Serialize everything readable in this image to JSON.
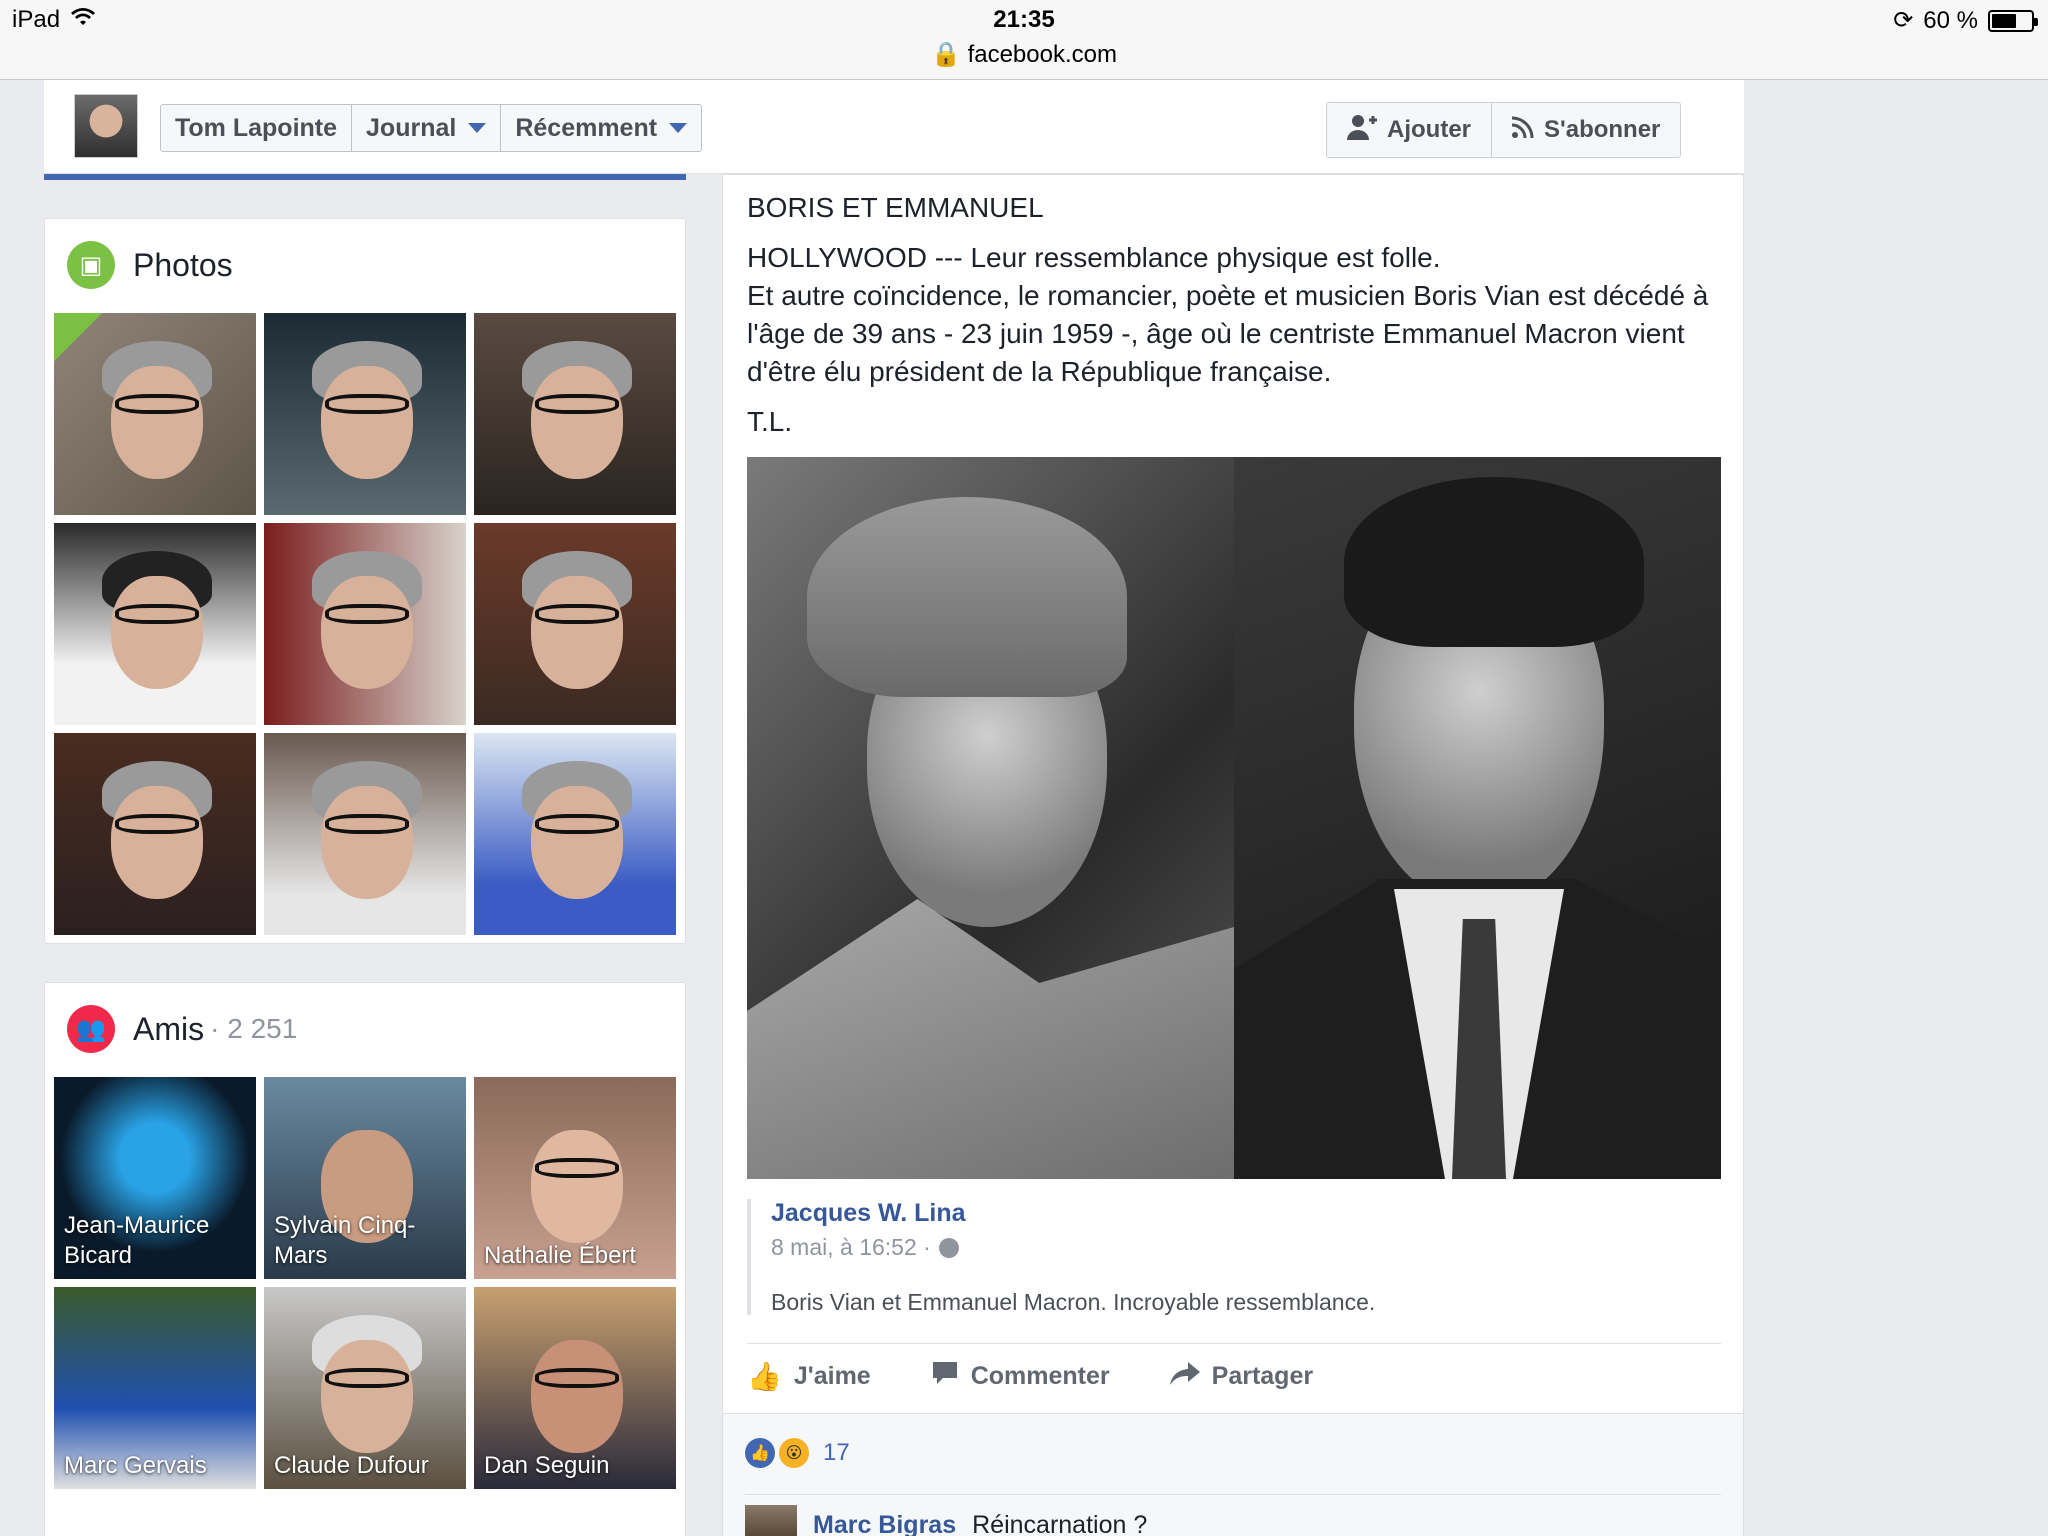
{
  "status_bar": {
    "device": "iPad",
    "time": "21:35",
    "url": "facebook.com",
    "battery": "60 %"
  },
  "topbar": {
    "profile_name": "Tom Lapointe",
    "journal_label": "Journal",
    "recent_label": "Récemment",
    "add_label": "Ajouter",
    "subscribe_label": "S'abonner"
  },
  "photos": {
    "title": "Photos"
  },
  "friends": {
    "title": "Amis",
    "count": "· 2 251",
    "items": [
      {
        "name": "Jean-Maurice Bicard"
      },
      {
        "name": "Sylvain Cinq-Mars"
      },
      {
        "name": "Nathalie Ébert"
      },
      {
        "name": "Marc Gervais"
      },
      {
        "name": "Claude Dufour"
      },
      {
        "name": "Dan Seguin"
      }
    ]
  },
  "post": {
    "heading": "BORIS ET EMMANUEL",
    "body_line1": "HOLLYWOOD --- Leur ressemblance physique est folle.",
    "body_line2": "Et autre coïncidence, le romancier, poète et musicien Boris Vian est décédé à l'âge de 39 ans - 23 juin 1959 -, âge où le centriste Emmanuel Macron vient d'être élu président de la République française.",
    "signature": "T.L.",
    "shared_author": "Jacques W. Lina",
    "shared_date": "8 mai, à 16:52 ·",
    "shared_text": "Boris Vian et Emmanuel Macron. Incroyable ressemblance.",
    "like_label": "J'aime",
    "comment_label": "Commenter",
    "share_label": "Partager",
    "reaction_count": "17",
    "comment_author": "Marc Bigras",
    "comment_text": "Réincarnation ?"
  },
  "colors": {
    "brand_blue": "#4267b2",
    "link_blue": "#365899",
    "photos_icon": "#7bc144",
    "friends_icon": "#f02849"
  }
}
